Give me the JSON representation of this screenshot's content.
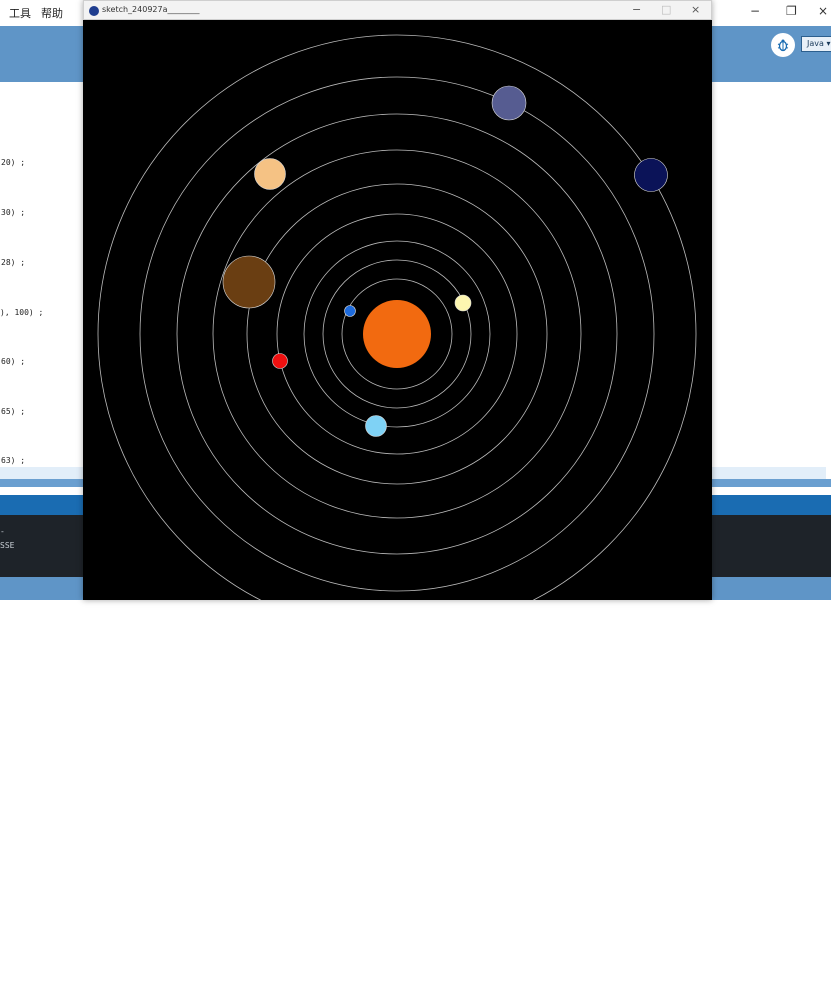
{
  "ide": {
    "menu": [
      "工具",
      "帮助"
    ],
    "mode_label": "Java ▾",
    "code_fragments": [
      "20) ;",
      "30) ;",
      "28) ;",
      "), 100) ;",
      "60) ;",
      "65) ;",
      "63) ;"
    ],
    "console_lines": [
      "-",
      "SSE"
    ]
  },
  "window": {
    "title": "sketch_240927a________",
    "controls": {
      "minimize": "−",
      "maximize": "□",
      "close": "×"
    }
  },
  "scene": {
    "background": "#000000",
    "orbit_color": "#bcbcbc",
    "sun": {
      "color": "#f26a10"
    },
    "orbits": 9,
    "planets": [
      {
        "name": "blue-dwarf",
        "color": "#1e6bdc"
      },
      {
        "name": "pale-yellow",
        "color": "#fdf6b0"
      },
      {
        "name": "red",
        "color": "#ee1010"
      },
      {
        "name": "light-blue",
        "color": "#7fd2f5"
      },
      {
        "name": "brown-giant",
        "color": "#6a3e12"
      },
      {
        "name": "peach",
        "color": "#f5c284"
      },
      {
        "name": "slate-blue",
        "color": "#565c91"
      },
      {
        "name": "navy",
        "color": "#0b1358"
      }
    ]
  }
}
